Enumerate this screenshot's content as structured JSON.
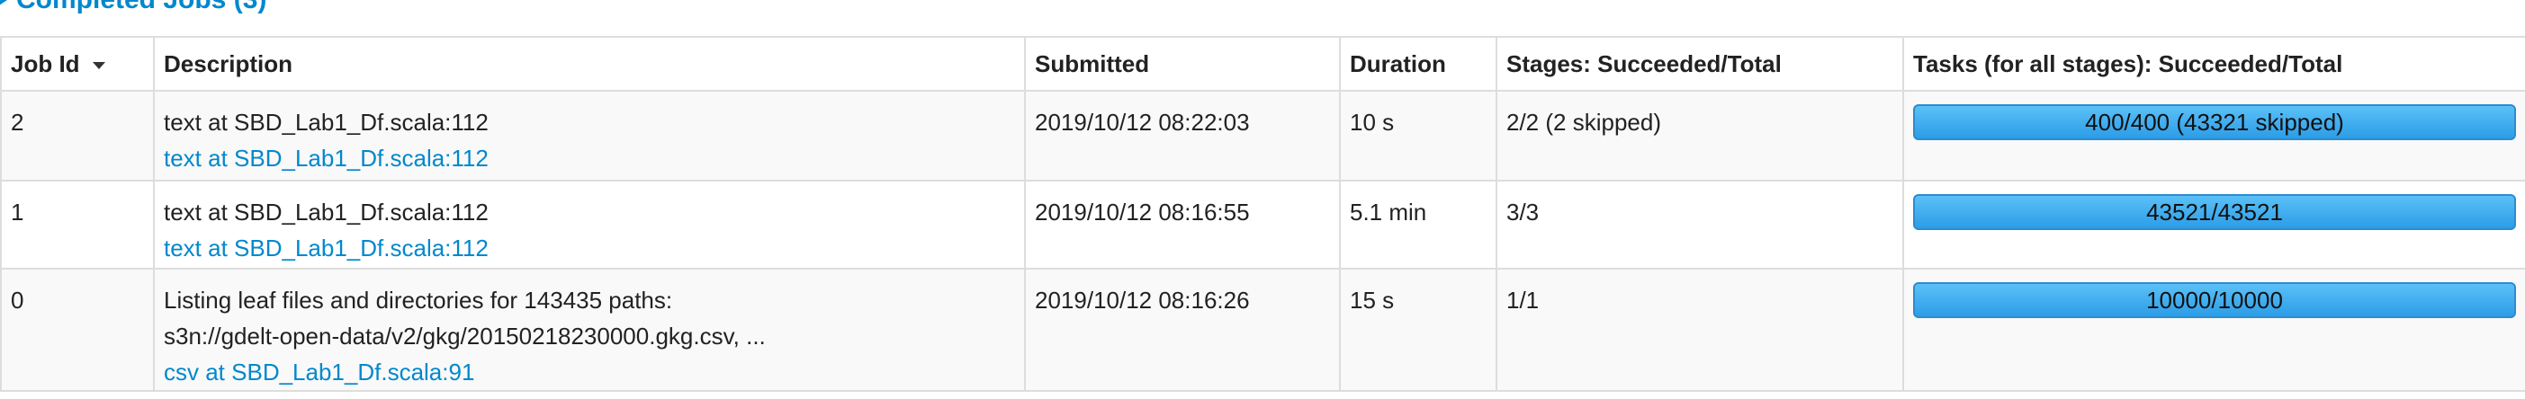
{
  "section": {
    "title": "Completed Jobs (3)"
  },
  "table": {
    "headers": {
      "job_id": "Job Id",
      "description": "Description",
      "submitted": "Submitted",
      "duration": "Duration",
      "stages": "Stages: Succeeded/Total",
      "tasks": "Tasks (for all stages): Succeeded/Total"
    },
    "sort": {
      "column": "job_id",
      "direction": "descending"
    },
    "rows": [
      {
        "job_id": "2",
        "description_lines": [
          "text at SBD_Lab1_Df.scala:112"
        ],
        "link": "text at SBD_Lab1_Df.scala:112",
        "submitted": "2019/10/12 08:22:03",
        "duration": "10 s",
        "stages": "2/2 (2 skipped)",
        "tasks_label": "400/400 (43321 skipped)",
        "tasks_progress": 1.0
      },
      {
        "job_id": "1",
        "description_lines": [
          "text at SBD_Lab1_Df.scala:112"
        ],
        "link": "text at SBD_Lab1_Df.scala:112",
        "submitted": "2019/10/12 08:16:55",
        "duration": "5.1 min",
        "stages": "3/3",
        "tasks_label": "43521/43521",
        "tasks_progress": 1.0
      },
      {
        "job_id": "0",
        "description_lines": [
          "Listing leaf files and directories for 143435 paths:",
          "s3n://gdelt-open-data/v2/gkg/20150218230000.gkg.csv, ..."
        ],
        "link": "csv at SBD_Lab1_Df.scala:91",
        "submitted": "2019/10/12 08:16:26",
        "duration": "15 s",
        "stages": "1/1",
        "tasks_label": "10000/10000",
        "tasks_progress": 1.0
      }
    ]
  },
  "colors": {
    "link": "#0088cc",
    "progress_start": "#5bc0f7",
    "progress_end": "#2b9de8"
  },
  "icons": {
    "section_toggle": "collapse-arrow-icon",
    "sort": "sort-descending-icon"
  }
}
